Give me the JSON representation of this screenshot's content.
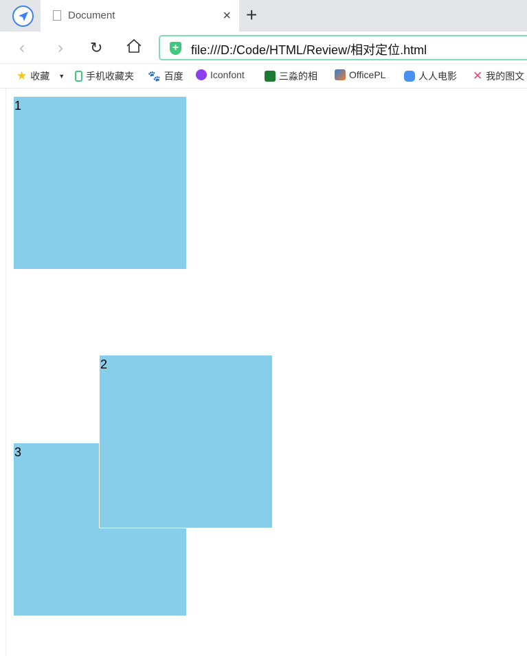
{
  "tab": {
    "title": "Document"
  },
  "address": {
    "url": "file:///D:/Code/HTML/Review/相对定位.html"
  },
  "bookmarks": [
    {
      "label": "收藏",
      "icon": "star-icon"
    },
    {
      "label": "手机收藏夹",
      "icon": "phone-icon"
    },
    {
      "label": "百度",
      "icon": "baidu-icon"
    },
    {
      "label": "Iconfont",
      "icon": "iconfont-icon"
    },
    {
      "label": "三淼的相",
      "icon": "douban-icon"
    },
    {
      "label": "OfficePL",
      "icon": "officeplus-icon"
    },
    {
      "label": "人人电影",
      "icon": "rr-icon"
    },
    {
      "label": "我的图文",
      "icon": "cross-icon"
    }
  ],
  "boxes": [
    {
      "label": "1"
    },
    {
      "label": "2"
    },
    {
      "label": "3"
    }
  ],
  "colors": {
    "box": "#87ceeb",
    "address_border": "#7ddcb0"
  }
}
